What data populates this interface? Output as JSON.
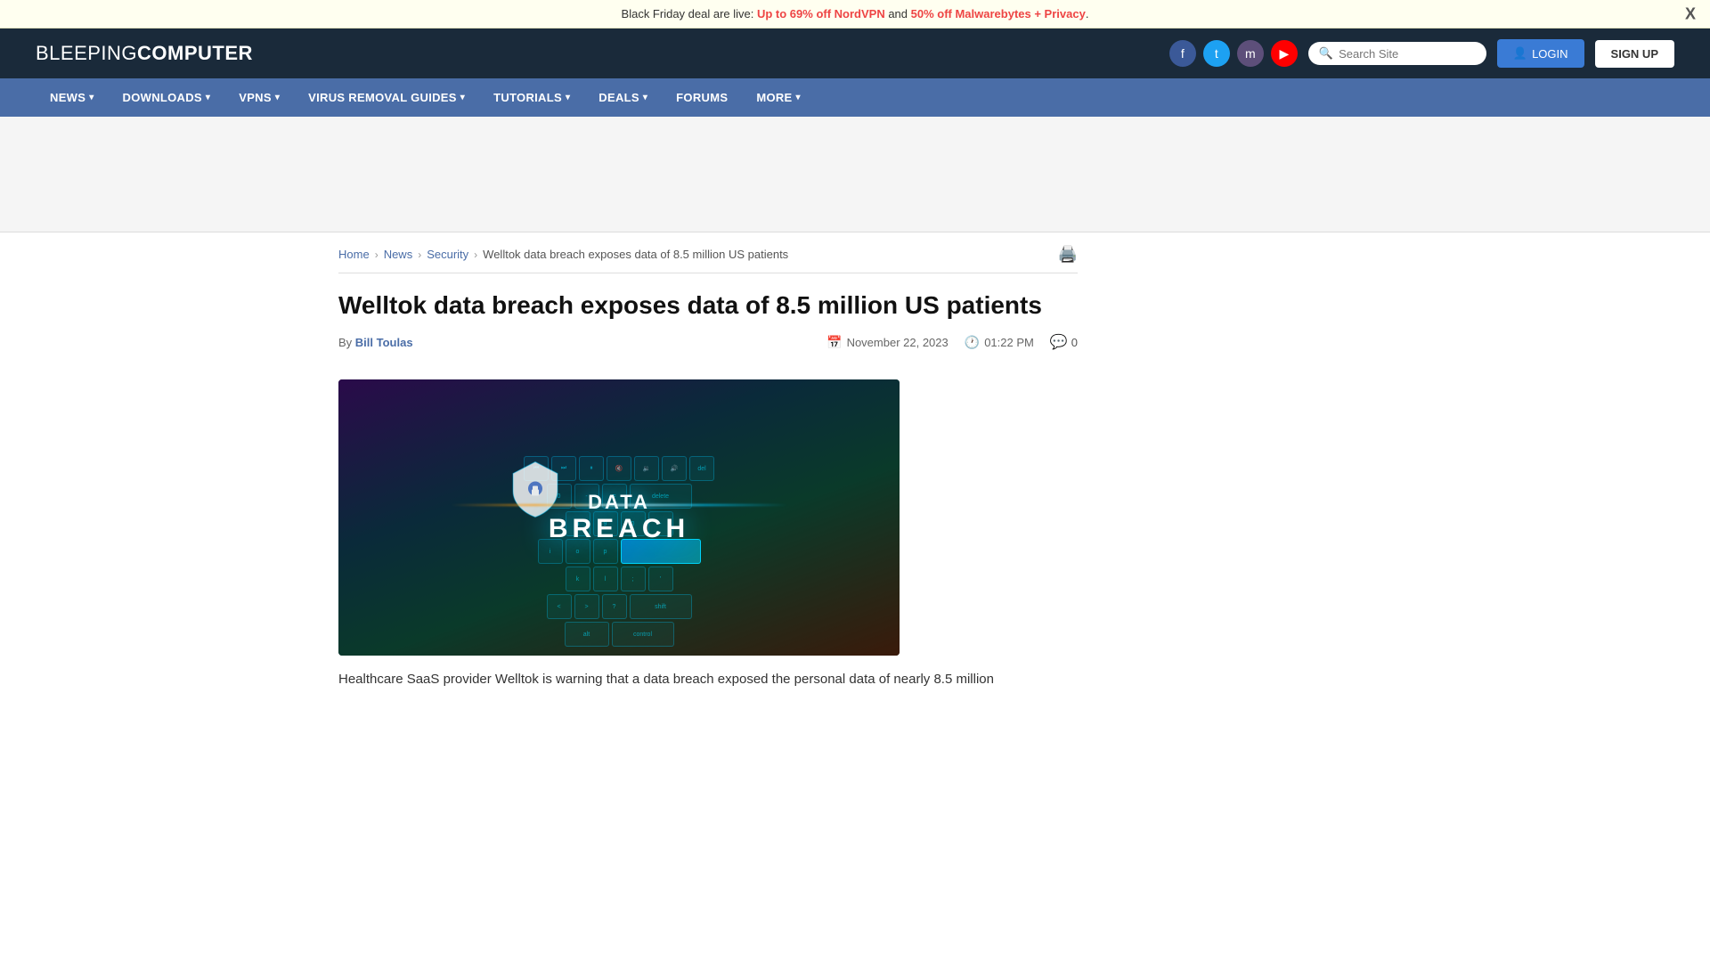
{
  "announcement": {
    "prefix": "Black Friday deal are live: ",
    "nordvpn_text": "Up to 69% off NordVPN",
    "connector": " and ",
    "malwarebytes_text": "50% off Malwarebytes + Privacy",
    "suffix": ".",
    "close_label": "X"
  },
  "header": {
    "logo_part1": "BLEEPING",
    "logo_part2": "COMPUTER",
    "search_placeholder": "Search Site",
    "login_label": "LOGIN",
    "signup_label": "SIGN UP"
  },
  "social": {
    "facebook": "f",
    "twitter": "t",
    "mastodon": "m",
    "youtube": "▶"
  },
  "nav": {
    "items": [
      {
        "label": "NEWS",
        "has_arrow": true
      },
      {
        "label": "DOWNLOADS",
        "has_arrow": true
      },
      {
        "label": "VPNS",
        "has_arrow": true
      },
      {
        "label": "VIRUS REMOVAL GUIDES",
        "has_arrow": true
      },
      {
        "label": "TUTORIALS",
        "has_arrow": true
      },
      {
        "label": "DEALS",
        "has_arrow": true
      },
      {
        "label": "FORUMS",
        "has_arrow": false
      },
      {
        "label": "MORE",
        "has_arrow": true
      }
    ]
  },
  "breadcrumb": {
    "home": "Home",
    "news": "News",
    "security": "Security",
    "current": "Welltok data breach exposes data of 8.5 million US patients"
  },
  "article": {
    "title": "Welltok data breach exposes data of 8.5 million US patients",
    "author": "Bill Toulas",
    "date": "November 22, 2023",
    "time": "01:22 PM",
    "comments": "0",
    "image_alt": "Data Breach keyboard image",
    "image_text_top": "DATA",
    "image_text_bottom": "BREACH",
    "body_start": "Healthcare SaaS provider Welltok is warning that a data breach exposed the personal data of nearly 8.5 million"
  }
}
